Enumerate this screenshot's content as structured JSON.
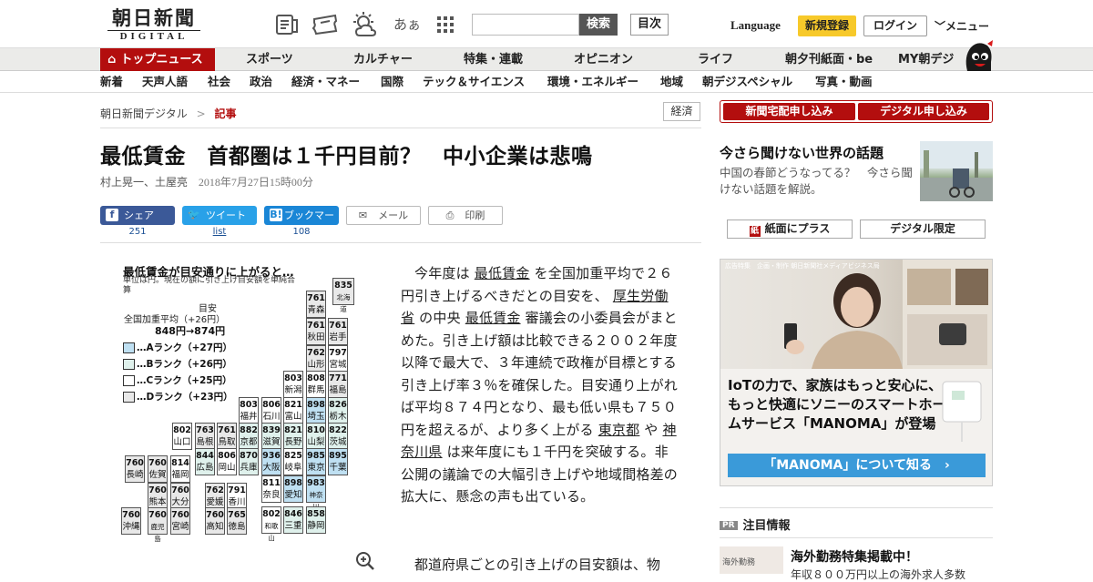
{
  "header": {
    "logo_jp": "朝日新聞",
    "logo_en": "DIGITAL",
    "search_button": "検索",
    "toc_button": "目次",
    "language": "Language",
    "register": "新規登録",
    "login": "ログイン",
    "menu": "メニュー",
    "icon_kana": "あぁ"
  },
  "nav_primary": {
    "active": "トップニュース",
    "items": [
      "スポーツ",
      "カルチャー",
      "特集・連載",
      "オピニオン",
      "ライフ",
      "朝夕刊紙面・be",
      "MY朝デジ"
    ]
  },
  "nav_secondary": [
    "新着",
    "天声人語",
    "社会",
    "政治",
    "経済・マネー",
    "国際",
    "テック＆サイエンス",
    "環境・エネルギー",
    "地域",
    "朝デジスペシャル",
    "写真・動画"
  ],
  "breadcrumb": {
    "home": "朝日新聞デジタル",
    "sep": ">",
    "current": "記事"
  },
  "category_tag": "経済",
  "article": {
    "title": "最低賃金　首都圏は１千円目前？　中小企業は悲鳴",
    "authors": "村上晃一、土屋亮",
    "date": "2018年7月27日15時00分",
    "para1_parts": [
      "今年度は ",
      "最低賃金",
      " を全国加重平均で２６円引き上げるべきだとの目安を、 ",
      "厚生労働省",
      " の中央 ",
      "最低賃金",
      " 審議会の小委員会がまとめた。引き上げ額は比較できる２００２年度以降で最大で、３年連続で政権が目標とする引き上げ率３％を確保した。目安通り上がれば平均８７４円となり、最も低い県も７５０円を超えるが、より多く上がる ",
      "東京都",
      " や ",
      "神奈川県",
      " は来年度にも１千円を突破する。非公開の議論での大幅引き上げや地域間格差の拡大に、懸念の声も出ている。"
    ],
    "para2": "都道府県ごとの引き上げの目安額は、物"
  },
  "share": {
    "facebook": "シェア",
    "facebook_count": "251",
    "twitter": "ツイート",
    "twitter_count": "list",
    "hatena": "ブックマーク",
    "hatena_count": "108",
    "mail": "メール",
    "print": "印刷"
  },
  "map": {
    "title": "最低賃金が目安通りに上がると…",
    "note": "単位は円。現在の額に引き上げ目安額を単純合算",
    "avg_heading": "目安",
    "avg_label": "全国加重平均（+26円）",
    "avg_values": "848円→874円",
    "legend": [
      {
        "label": "…Aランク（+27円）",
        "color": "#bfe0f2"
      },
      {
        "label": "…Bランク（+26円）",
        "color": "#dff1ec"
      },
      {
        "label": "…Cランク（+25円）",
        "color": "#ffffff"
      },
      {
        "label": "…Dランク（+23円）",
        "color": "#e8e8e8"
      }
    ],
    "prefectures": [
      {
        "v": "835",
        "n": "北海道",
        "r": "rd"
      },
      {
        "v": "761",
        "n": "青森",
        "r": "rd"
      },
      {
        "v": "761",
        "n": "秋田",
        "r": "rd"
      },
      {
        "v": "761",
        "n": "岩手",
        "r": "rd"
      },
      {
        "v": "762",
        "n": "山形",
        "r": "rd"
      },
      {
        "v": "797",
        "n": "宮城",
        "r": "rc"
      },
      {
        "v": "803",
        "n": "新潟",
        "r": "rc"
      },
      {
        "v": "808",
        "n": "群馬",
        "r": "rc"
      },
      {
        "v": "771",
        "n": "福島",
        "r": "rd"
      },
      {
        "v": "803",
        "n": "福井",
        "r": "rc"
      },
      {
        "v": "806",
        "n": "石川",
        "r": "rc"
      },
      {
        "v": "821",
        "n": "富山",
        "r": "rc"
      },
      {
        "v": "898",
        "n": "埼玉",
        "r": "ra"
      },
      {
        "v": "826",
        "n": "栃木",
        "r": "rb"
      },
      {
        "v": "802",
        "n": "山口",
        "r": "rc"
      },
      {
        "v": "763",
        "n": "島根",
        "r": "rd"
      },
      {
        "v": "761",
        "n": "鳥取",
        "r": "rd"
      },
      {
        "v": "882",
        "n": "京都",
        "r": "rb"
      },
      {
        "v": "839",
        "n": "滋賀",
        "r": "rb"
      },
      {
        "v": "821",
        "n": "長野",
        "r": "rb"
      },
      {
        "v": "810",
        "n": "山梨",
        "r": "rb"
      },
      {
        "v": "822",
        "n": "茨城",
        "r": "rb"
      },
      {
        "v": "760",
        "n": "長崎",
        "r": "rd"
      },
      {
        "v": "760",
        "n": "佐賀",
        "r": "rd"
      },
      {
        "v": "814",
        "n": "福岡",
        "r": "rc"
      },
      {
        "v": "844",
        "n": "広島",
        "r": "rb"
      },
      {
        "v": "806",
        "n": "岡山",
        "r": "rc"
      },
      {
        "v": "870",
        "n": "兵庫",
        "r": "rb"
      },
      {
        "v": "936",
        "n": "大阪",
        "r": "ra"
      },
      {
        "v": "825",
        "n": "岐阜",
        "r": "rc"
      },
      {
        "v": "985",
        "n": "東京",
        "r": "ra"
      },
      {
        "v": "895",
        "n": "千葉",
        "r": "ra"
      },
      {
        "v": "811",
        "n": "奈良",
        "r": "rc"
      },
      {
        "v": "898",
        "n": "愛知",
        "r": "ra"
      },
      {
        "v": "983",
        "n": "神奈川",
        "r": "ra"
      },
      {
        "v": "760",
        "n": "熊本",
        "r": "rd"
      },
      {
        "v": "760",
        "n": "大分",
        "r": "rd"
      },
      {
        "v": "762",
        "n": "愛媛",
        "r": "rd"
      },
      {
        "v": "791",
        "n": "香川",
        "r": "rc"
      },
      {
        "v": "760",
        "n": "鹿児島",
        "r": "rd"
      },
      {
        "v": "760",
        "n": "宮崎",
        "r": "rd"
      },
      {
        "v": "760",
        "n": "高知",
        "r": "rd"
      },
      {
        "v": "765",
        "n": "徳島",
        "r": "rd"
      },
      {
        "v": "802",
        "n": "和歌山",
        "r": "rc"
      },
      {
        "v": "846",
        "n": "三重",
        "r": "rb"
      },
      {
        "v": "858",
        "n": "静岡",
        "r": "rb"
      },
      {
        "v": "760",
        "n": "沖縄",
        "r": "rd"
      }
    ]
  },
  "sidebar": {
    "apply_home": "新聞宅配申し込み",
    "apply_digital": "デジタル申し込み",
    "feature_title": "今さら聞けない世界の話題",
    "feature_desc": "中国の春節どうなってる？　今さら聞けない話題を解説。",
    "paper_plus": "紙面にプラス",
    "digital_only": "デジタル限定",
    "ad_label": "広告特集　企画・制作 朝日新聞社メディアビジネス局",
    "ad_headline": "IoTの力で、家族はもっと安心に、もっと快適にソニーのスマートホームサービス「MANOMA」が登場",
    "ad_cta": "「MANOMA」について知る　›",
    "pr_heading": "注目情報",
    "pr_badge": "PR",
    "pr_item_title": "海外勤務特集掲載中！",
    "pr_item_sub": "年収８００万円以上の海外求人多数",
    "pr_thumb_label": "海外勤務"
  },
  "colors": {
    "brand_red": "#b30e0e",
    "register_yellow": "#f7c92a",
    "facebook": "#3b5998",
    "twitter": "#29a1e8",
    "hatena": "#1a86d6",
    "ad_cta": "#3a9ad9"
  }
}
